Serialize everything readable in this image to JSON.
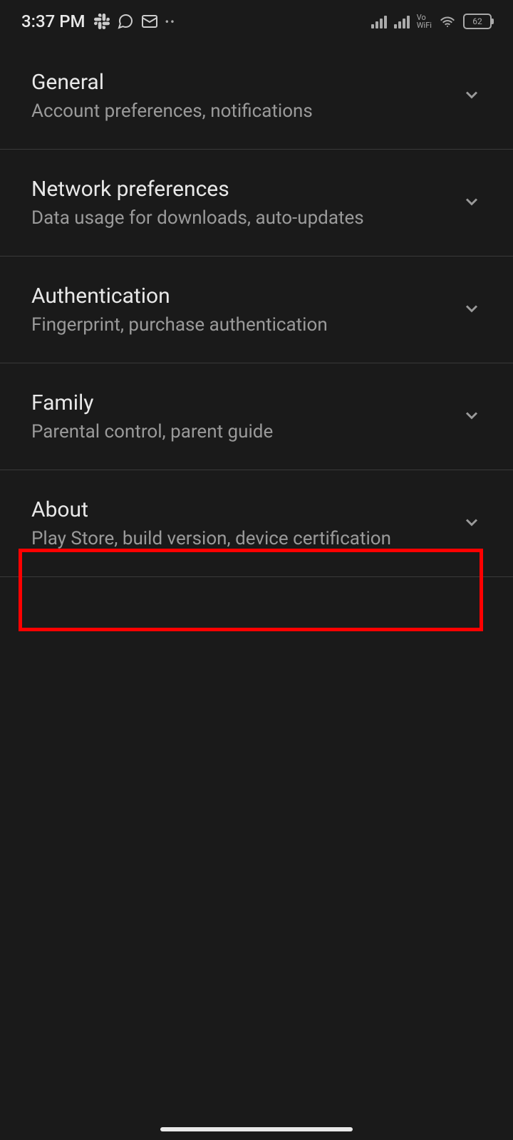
{
  "status_bar": {
    "time": "3:37 PM",
    "battery_level": "62",
    "vowifi_top": "Vo",
    "vowifi_bottom": "WiFi"
  },
  "settings": [
    {
      "title": "General",
      "subtitle": "Account preferences, notifications"
    },
    {
      "title": "Network preferences",
      "subtitle": "Data usage for downloads, auto-updates"
    },
    {
      "title": "Authentication",
      "subtitle": "Fingerprint, purchase authentication"
    },
    {
      "title": "Family",
      "subtitle": "Parental control, parent guide"
    },
    {
      "title": "About",
      "subtitle": "Play Store, build version, device certification"
    }
  ]
}
